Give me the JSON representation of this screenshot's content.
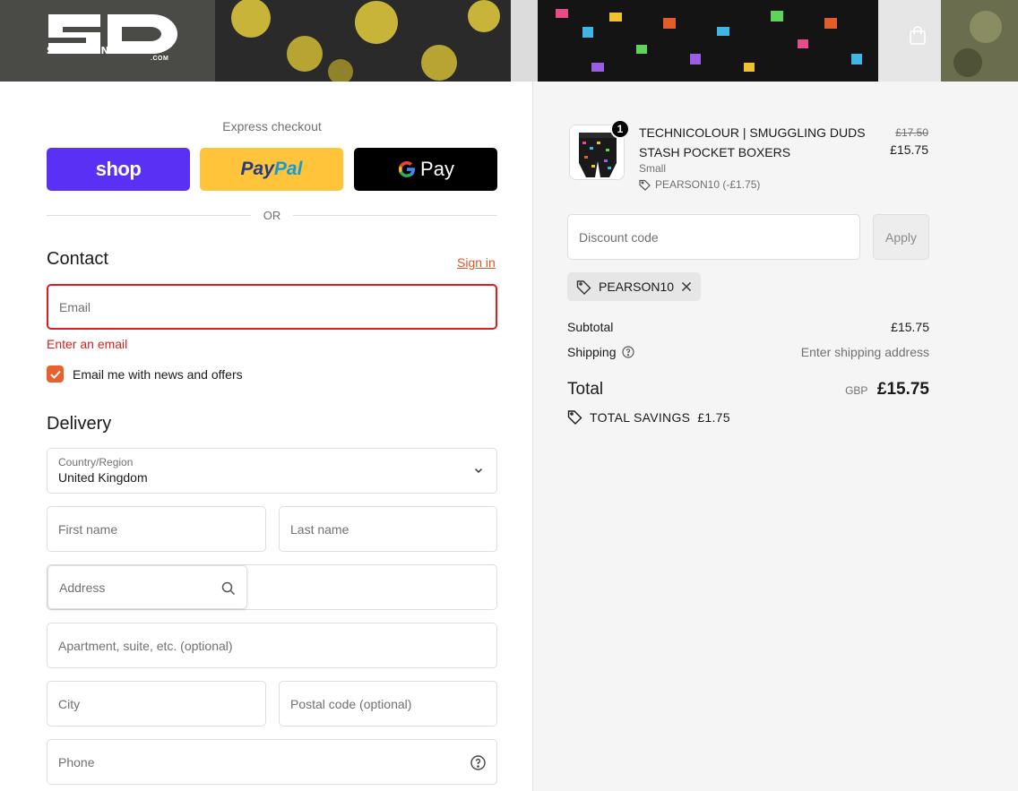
{
  "header": {
    "logo_text": "SMUGGLING DUDS",
    "logo_sub": ".COM"
  },
  "express": {
    "label": "Express checkout",
    "shop_label": "shop",
    "paypal_label_1": "Pay",
    "paypal_label_2": "Pal",
    "gpay_label": "Pay",
    "or_label": "OR"
  },
  "contact": {
    "title": "Contact",
    "sign_in": "Sign in",
    "email_placeholder": "Email",
    "email_error": "Enter an email",
    "newsletter_label": "Email me with news and offers",
    "newsletter_checked": true
  },
  "delivery": {
    "title": "Delivery",
    "country_label": "Country/Region",
    "country_value": "United Kingdom",
    "first_name": "First name",
    "last_name": "Last name",
    "address": "Address",
    "apartment": "Apartment, suite, etc. (optional)",
    "city": "City",
    "postal": "Postal code (optional)",
    "phone": "Phone"
  },
  "summary": {
    "product": {
      "qty": "1",
      "name": "TECHNICOLOUR | SMUGGLING DUDS STASH POCKET BOXERS",
      "variant": "Small",
      "discount": "PEARSON10 (-£1.75)",
      "price_old": "£17.50",
      "price_new": "£15.75"
    },
    "discount_placeholder": "Discount code",
    "apply_label": "Apply",
    "applied_code": "PEARSON10",
    "subtotal_label": "Subtotal",
    "subtotal_value": "£15.75",
    "shipping_label": "Shipping",
    "shipping_value": "Enter shipping address",
    "total_label": "Total",
    "currency": "GBP",
    "total_value": "£15.75",
    "savings_label": "TOTAL SAVINGS",
    "savings_value": "£1.75"
  },
  "colors": {
    "accent": "#e8602c",
    "error": "#dd1d1d",
    "shop": "#5a31f4",
    "paypal": "#ffc439"
  }
}
